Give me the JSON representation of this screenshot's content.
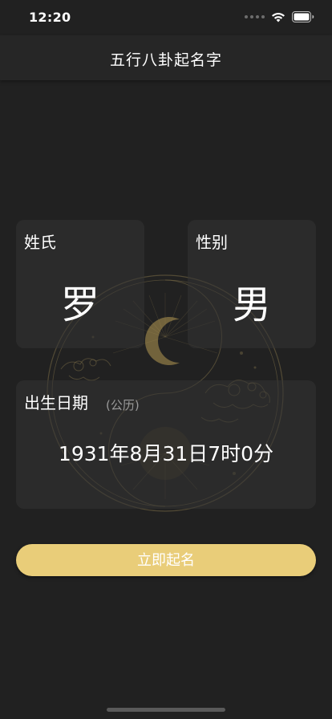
{
  "status_bar": {
    "time": "12:20",
    "icons": [
      "signal-icon",
      "wifi-icon",
      "battery-icon"
    ]
  },
  "nav": {
    "title": "五行八卦起名字"
  },
  "surname_card": {
    "label": "姓氏",
    "value": "罗"
  },
  "gender_card": {
    "label": "性别",
    "value": "男"
  },
  "birth_card": {
    "label": "出生日期",
    "calendar_note": "(公历)",
    "value": "1931年8月31日7时0分"
  },
  "action": {
    "submit_label": "立即起名"
  },
  "colors": {
    "background": "#212121",
    "accent": "#e9cd79",
    "card": "#343434",
    "emblem": "#8a7a4e"
  }
}
